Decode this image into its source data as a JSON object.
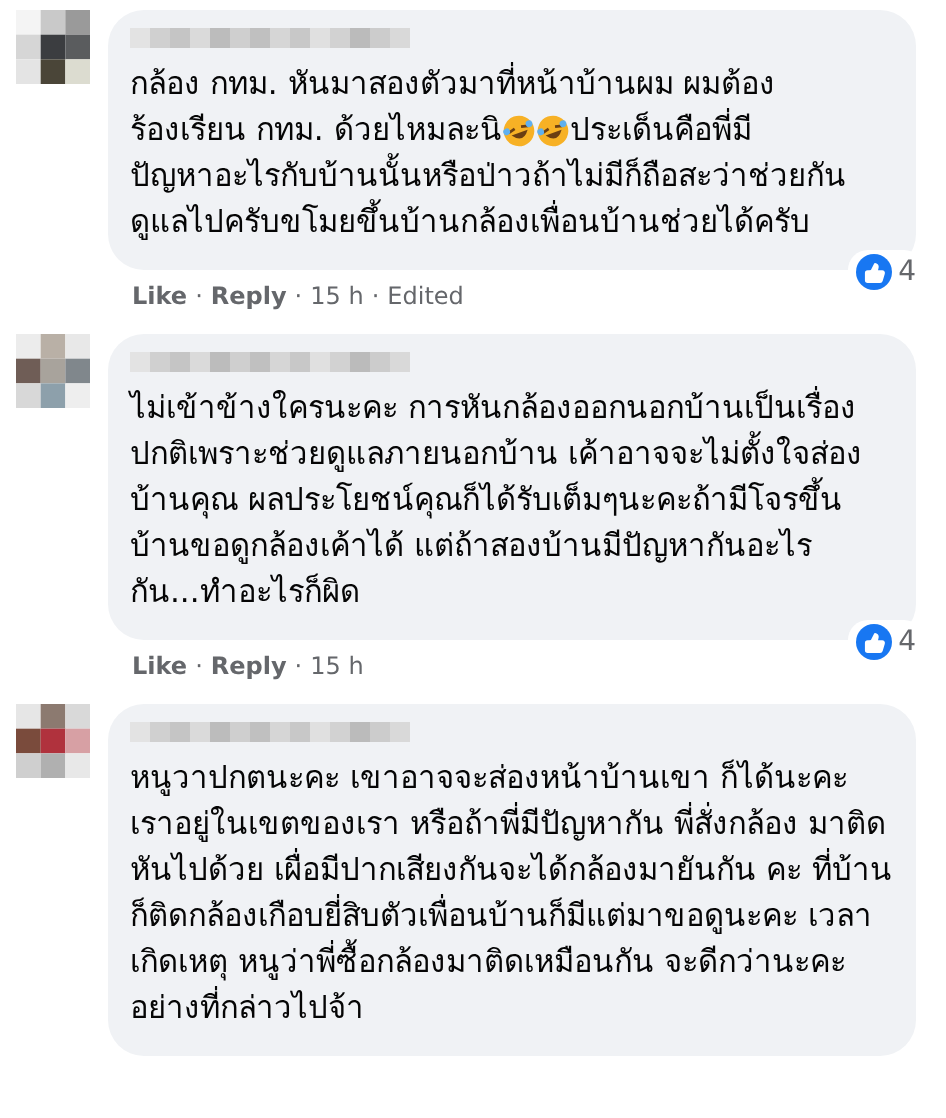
{
  "separator": "·",
  "comments": [
    {
      "segments": [
        {
          "kind": "text",
          "text": "กล้อง กทม. หันมาสองตัวมาที่หน้าบ้านผม ผมต้อง"
        },
        {
          "kind": "mixed",
          "parts": [
            {
              "kind": "text",
              "text": "ร้องเรียน กทม. ด้วยไหมละนิ"
            },
            {
              "kind": "emoji"
            },
            {
              "kind": "emoji"
            },
            {
              "kind": "text",
              "text": "ประเด็นคือพี่มี"
            }
          ]
        },
        {
          "kind": "text",
          "text": "ปัญหาอะไรกับบ้านนั้นหรือป่าวถ้าไม่มีก็ถือสะว่าช่วยกันดูแลไปครับขโมยขึ้นบ้านกล้องเพื่อนบ้านช่วยได้ครับ"
        }
      ],
      "reactions": "4",
      "meta": [
        {
          "kind": "link",
          "text": "Like"
        },
        {
          "kind": "link",
          "text": "Reply"
        },
        {
          "kind": "text",
          "text": "15 h"
        },
        {
          "kind": "text",
          "text": "Edited"
        }
      ]
    },
    {
      "segments": [
        {
          "kind": "text",
          "text": "ไม่เข้าข้างใครนะคะ การหันกล้องออกนอกบ้านเป็นเรื่องปกติเพราะช่วยดูแลภายนอกบ้าน เค้าอาจจะไม่ตั้งใจส่องบ้านคุณ ผลประโยชน์คุณก็ได้รับเต็มๆนะคะถ้ามีโจรขึ้นบ้านขอดูกล้องเค้าได้ แต่ถ้าสองบ้านมีปัญหากันอะไรกัน...ทำอะไรก็ผิด"
        }
      ],
      "reactions": "4",
      "meta": [
        {
          "kind": "link",
          "text": "Like"
        },
        {
          "kind": "link",
          "text": "Reply"
        },
        {
          "kind": "text",
          "text": "15 h"
        }
      ]
    },
    {
      "segments": [
        {
          "kind": "text",
          "text": "หนูวาปกตนะคะ เขาอาจจะส่องหน้าบ้านเขา ก็ได้นะคะ เราอยู่ในเขตของเรา หรือถ้าพี่มีปัญหากัน พี่สั่งกล้อง มาติดหันไปด้วย เผื่อมีปากเสียงกันจะได้กล้องมายันกัน คะ ที่บ้านก็ติดกล้องเกือบยี่สิบตัวเพื่อนบ้านก็มีแต่มาขอดูนะคะ เวลาเกิดเหตุ หนูว่าพี่ซื้อกล้องมาติดเหมือนกัน จะดีกว่านะคะ อย่างที่กล่าวไปจ้า"
        }
      ]
    }
  ]
}
